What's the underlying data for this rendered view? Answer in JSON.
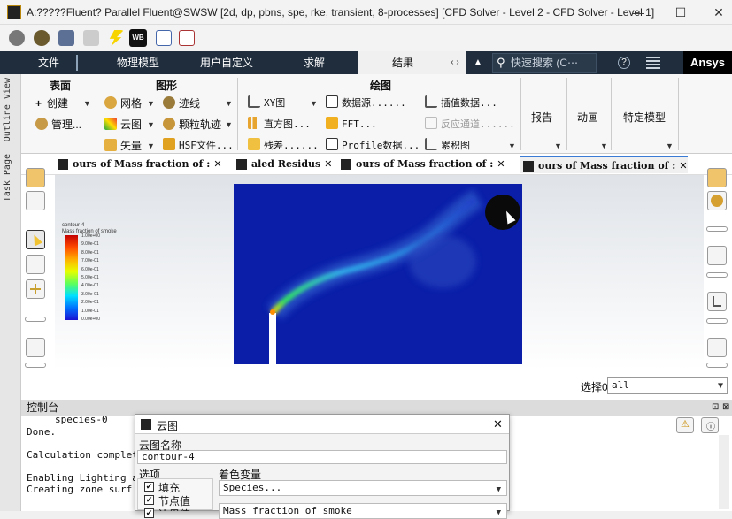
{
  "window": {
    "title": "A:?????Fluent? Parallel Fluent@SWSW  [2d, dp, pbns, spe, rke, transient, 8-processes] [CFD Solver - Level 2 - CFD Solver - Level 1]",
    "minimize": "—",
    "maximize": "☐",
    "close": "✕"
  },
  "menubar": {
    "items": [
      "文件",
      "物理模型",
      "用户自定义",
      "求解",
      "结果"
    ],
    "arrows": "‹ ›",
    "search_placeholder": "快速搜索 (C⋯",
    "brand": "Ansys",
    "help": "?"
  },
  "ribbon": {
    "groups": {
      "surface": "表面",
      "graphics": "图形",
      "plots": "绘图"
    },
    "surface_items": [
      "创建",
      "管理..."
    ],
    "graphics_items": [
      "网格",
      "云图",
      "矢量",
      "迹线",
      "颗粒轨迹",
      "HSF文件..."
    ],
    "plots_items": [
      "XY图",
      "直方图...",
      "残差......",
      "数据源......",
      "FFT...",
      "Profile数据...",
      "插值数据...",
      "反应通道......",
      "累积图"
    ],
    "right_items": [
      "报告",
      "动画",
      "特定模型"
    ]
  },
  "left_tabs": [
    "Outline View",
    "Task Page"
  ],
  "graphics_tabs": [
    "ours of Mass fraction of :",
    "aled Residus",
    "ours of Mass fraction of :",
    "ours of Mass fraction of :"
  ],
  "legend": {
    "title": "contour-4",
    "subtitle": "Mass fraction of smoke",
    "values": [
      "1.00e+00",
      "9.00e-01",
      "8.00e-01",
      "7.00e-01",
      "6.00e-01",
      "5.00e-01",
      "4.00e-01",
      "3.00e-01",
      "2.00e-01",
      "1.00e-01",
      "0.00e+00"
    ]
  },
  "selection": {
    "label": "选择0",
    "value": "all"
  },
  "console": {
    "title": "控制台",
    "lines": [
      "species-0",
      "Done.",
      "",
      "Calculation complet",
      "",
      "Enabling Lighting a",
      "Creating zone surf"
    ]
  },
  "dialog": {
    "title": "云图",
    "name_label": "云图名称",
    "name_value": "contour-4",
    "options_label": "选项",
    "options": [
      "填充",
      "节点值",
      "边界值"
    ],
    "color_label": "着色变量",
    "color_var1": "Species...",
    "color_var2": "Mass fraction of smoke"
  },
  "colors": {
    "menubar": "#1f2d3d",
    "contour_bg": "#0a1ea8"
  }
}
